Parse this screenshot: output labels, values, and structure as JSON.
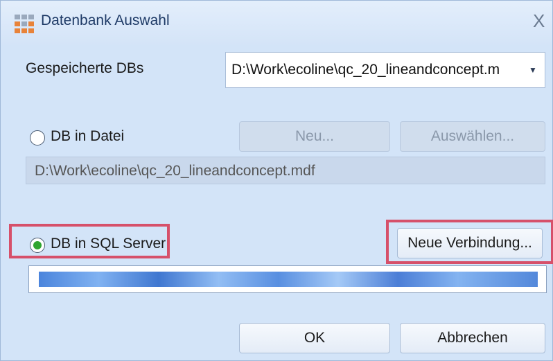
{
  "window": {
    "title": "Datenbank Auswahl",
    "close_glyph": "X"
  },
  "saved_dbs": {
    "label": "Gespeicherte DBs",
    "selected": "D:\\Work\\ecoline\\qc_20_lineandconcept.m",
    "arrow_glyph": "▼"
  },
  "file_db": {
    "label": "DB in Datei",
    "checked": false,
    "new_button": "Neu...",
    "select_button": "Auswählen...",
    "path": "D:\\Work\\ecoline\\qc_20_lineandconcept.mdf"
  },
  "sql_db": {
    "label": "DB in SQL Server",
    "checked": true,
    "new_connection_button": "Neue Verbindung...",
    "connection_string": ""
  },
  "footer": {
    "ok_button": "OK",
    "cancel_button": "Abbrechen"
  },
  "colors": {
    "highlight": "#d6506a",
    "radio_selected": "#2fa52f",
    "dialog_bg": "#d3e4f8"
  },
  "icons": [
    "app-grid-icon",
    "close-icon",
    "dropdown-arrow-icon",
    "radio-unchecked-icon",
    "radio-checked-icon"
  ]
}
